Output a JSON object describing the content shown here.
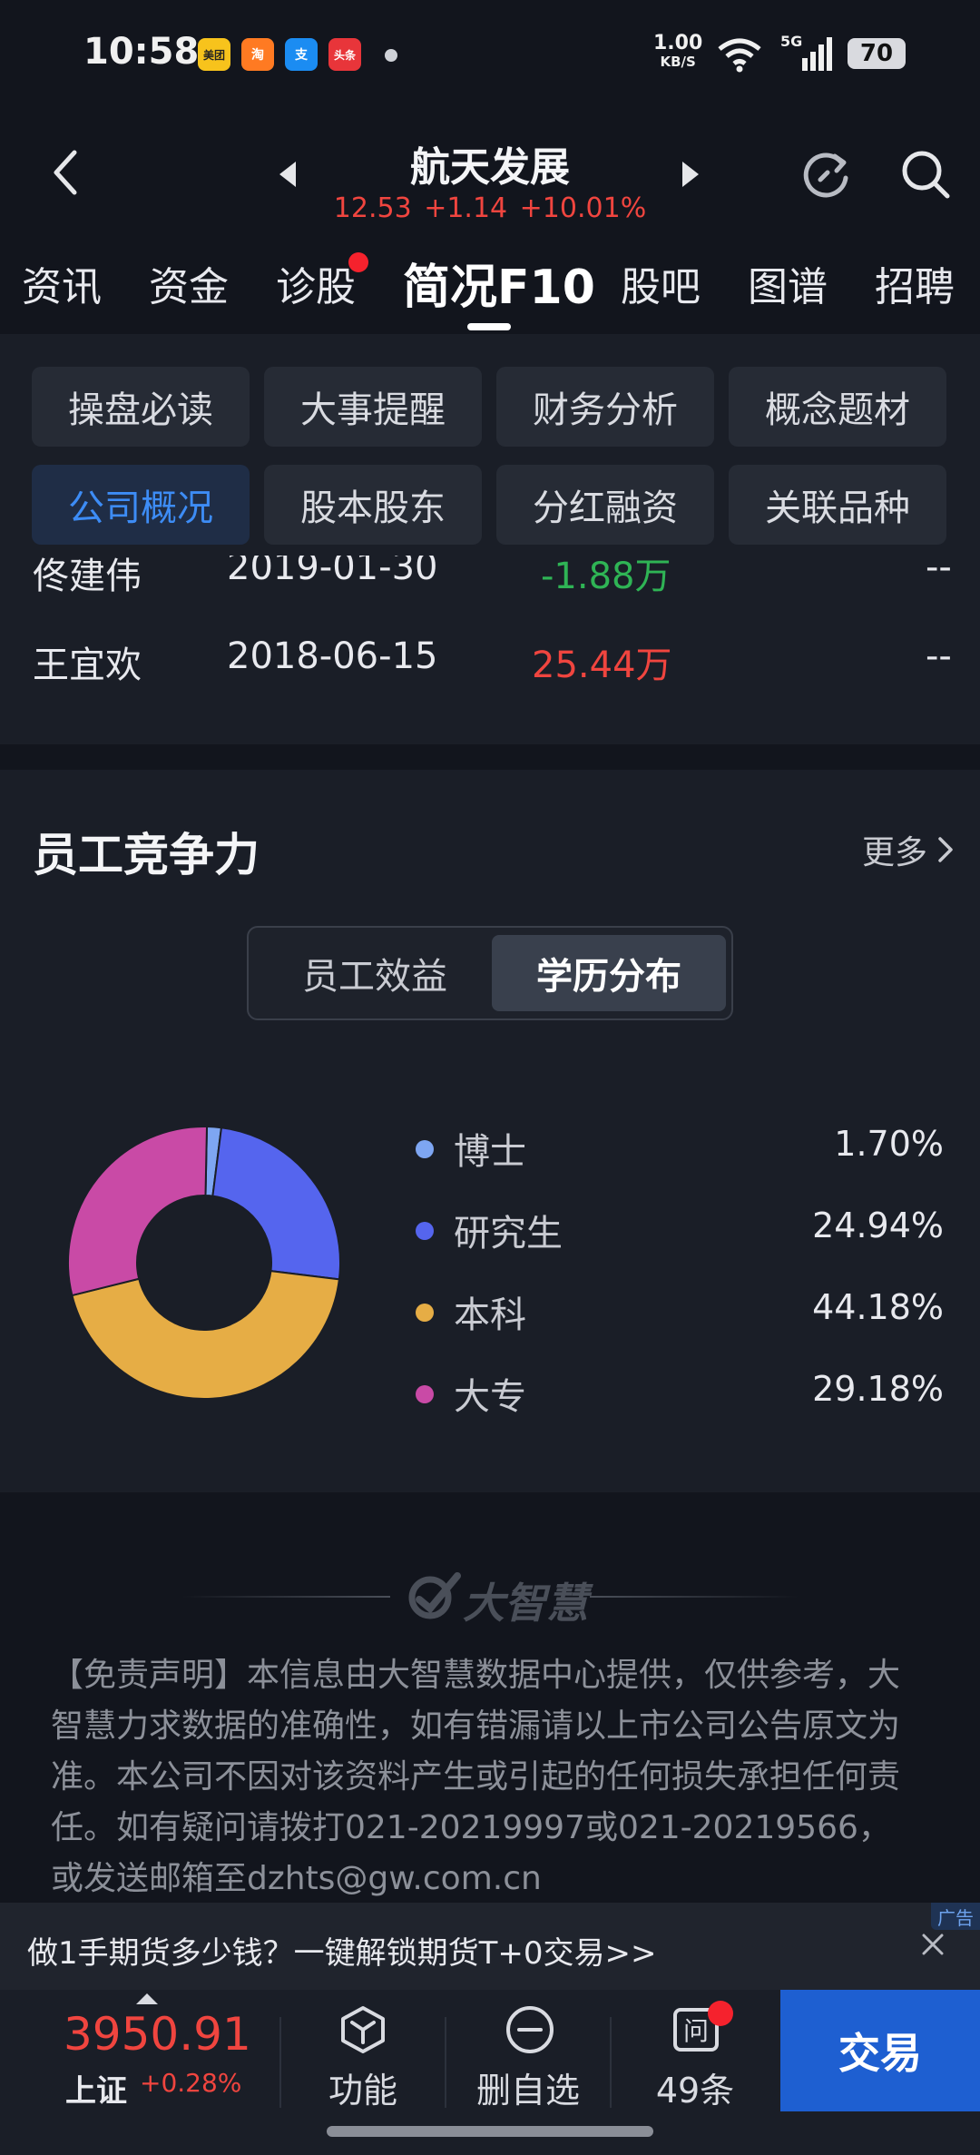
{
  "status_bar": {
    "time": "10:58",
    "app_icons": [
      "美团",
      "淘",
      "支",
      "头条"
    ],
    "net_speed": "1.00",
    "net_unit": "KB/S",
    "signal": "5G",
    "battery": "70"
  },
  "header": {
    "title": "航天发展",
    "quote": "12.53  +1.14  +10.01%"
  },
  "tabs": [
    {
      "label": "资讯"
    },
    {
      "label": "资金"
    },
    {
      "label": "诊股"
    },
    {
      "label": "简况F10"
    },
    {
      "label": "股吧"
    },
    {
      "label": "图谱"
    },
    {
      "label": "招聘"
    }
  ],
  "grid_buttons": [
    "操盘必读",
    "大事提醒",
    "财务分析",
    "概念题材",
    "公司概况",
    "股本股东",
    "分红融资",
    "关联品种"
  ],
  "table_rows": [
    {
      "name": "佟建伟",
      "date": "2019-01-30",
      "amount": "-1.88万",
      "extra": "--"
    },
    {
      "name": "王宜欢",
      "date": "2018-06-15",
      "amount": "25.44万",
      "extra": "--"
    }
  ],
  "employee": {
    "title": "员工竞争力",
    "more": "更多",
    "seg_off": "员工效益",
    "seg_on": "学历分布"
  },
  "chart_data": {
    "type": "pie",
    "title": "",
    "categories": [
      "博士",
      "研究生",
      "本科",
      "大专"
    ],
    "values": [
      1.7,
      24.94,
      44.18,
      29.18
    ],
    "labels": [
      "1.70%",
      "24.94%",
      "44.18%",
      "29.18%"
    ],
    "colors": [
      "#7ea6f2",
      "#5565ee",
      "#e6ad45",
      "#c94aa6"
    ],
    "legend": "right"
  },
  "footer": {
    "logo": "大智慧",
    "disclaimer": "【免责声明】本信息由大智慧数据中心提供，仅供参考，大智慧力求数据的准确性，如有错漏请以上市公司公告原文为准。本公司不因对该资料产生或引起的任何损失承担任何责任。如有疑问请拨打021-20219997或021-20219566，或发送邮箱至dzhts@gw.com.cn"
  },
  "ad": {
    "text": "做1手期货多少钱？一键解锁期货T+0交易>>",
    "tag": "广告"
  },
  "bottom_bar": {
    "index_value": "3950.91",
    "index_name": "上证",
    "index_change": "+0.28%",
    "func_label": "功能",
    "remove_label": "删自选",
    "ask_label": "49条",
    "trade_label": "交易"
  }
}
